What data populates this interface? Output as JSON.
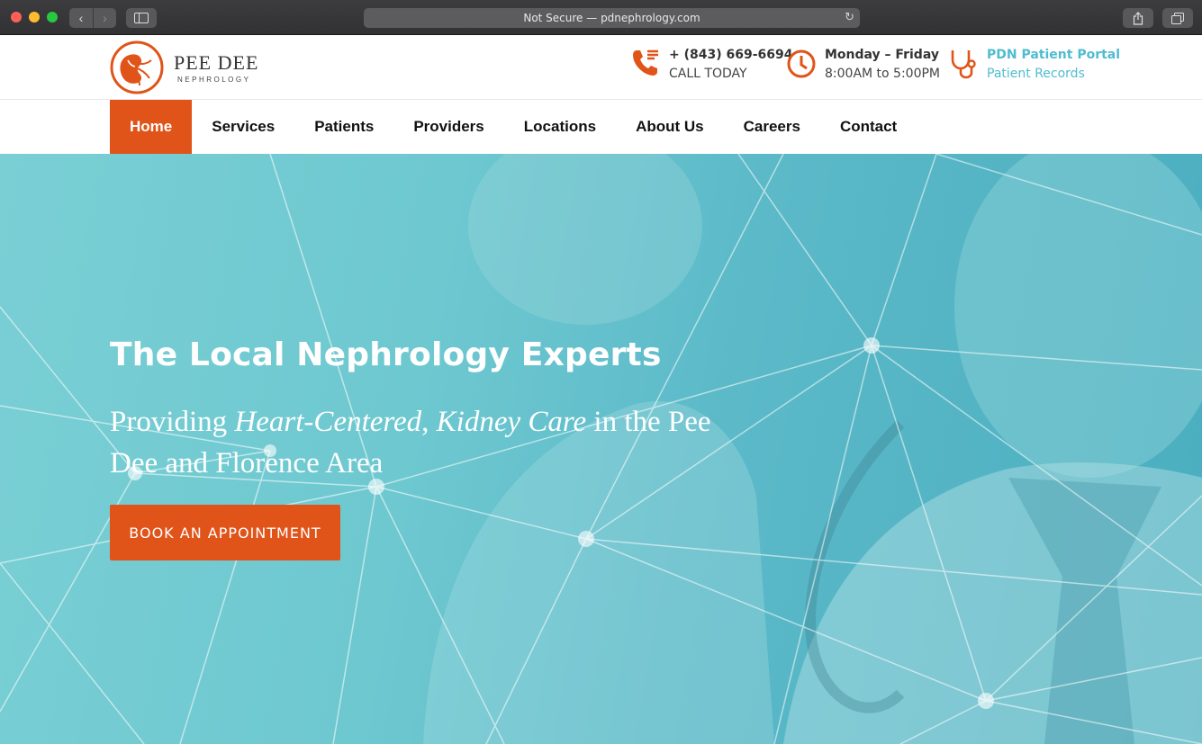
{
  "browser": {
    "url_text": "Not Secure — pdnephrology.com"
  },
  "logo": {
    "name": "PEE DEE",
    "sub": "NEPHROLOGY"
  },
  "contact": {
    "phone_line1": "+ (843) 669-6694",
    "phone_line2": "CALL TODAY",
    "hours_line1": "Monday – Friday",
    "hours_line2": "8:00AM to 5:00PM",
    "portal_line1": "PDN Patient Portal",
    "portal_line2": "Patient Records"
  },
  "nav": {
    "items": [
      {
        "label": "Home"
      },
      {
        "label": "Services"
      },
      {
        "label": "Patients"
      },
      {
        "label": "Providers"
      },
      {
        "label": "Locations"
      },
      {
        "label": "About Us"
      },
      {
        "label": "Careers"
      },
      {
        "label": "Contact"
      }
    ],
    "active": "Home"
  },
  "hero": {
    "title": "The Local Nephrology Experts",
    "sub_part1": "Providing ",
    "sub_em1": "Heart-Centered",
    "sub_part2": ", ",
    "sub_em2": "Kidney Care",
    "sub_part3": " in the Pee Dee and Florence Area",
    "cta": "BOOK AN APPOINTMENT"
  },
  "colors": {
    "accent": "#e05419",
    "portal": "#4fbcd0",
    "hero_teal": "#6ec8d0"
  },
  "icons": [
    "phone-icon",
    "clock-icon",
    "stethoscope-icon",
    "kidney-logo-icon"
  ]
}
